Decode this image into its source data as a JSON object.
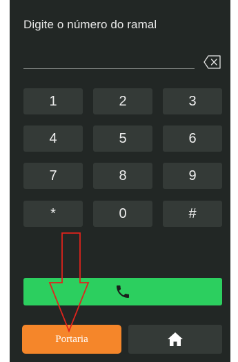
{
  "screen": {
    "prompt": "Digite o número do ramal",
    "extension_value": ""
  },
  "keypad": {
    "keys": [
      "1",
      "2",
      "3",
      "4",
      "5",
      "6",
      "7",
      "8",
      "9",
      "*",
      "0",
      "#"
    ]
  },
  "actions": {
    "call_icon": "phone-icon",
    "portaria_label": "Portaria",
    "home_icon": "home-icon"
  },
  "colors": {
    "background": "#222725",
    "key": "#343a37",
    "call": "#2ccf5f",
    "portaria": "#f5862a",
    "annotation_arrow": "#e0231c"
  }
}
